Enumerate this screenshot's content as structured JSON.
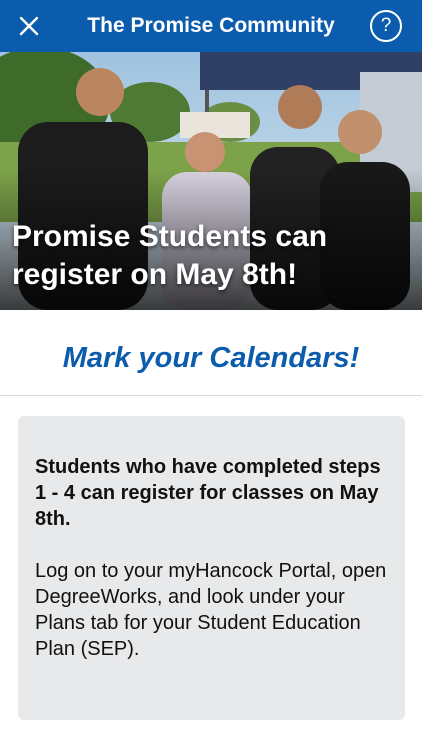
{
  "header": {
    "title": "The Promise Community",
    "close_icon": "close-icon",
    "help_icon": "help-icon",
    "help_glyph": "?"
  },
  "hero": {
    "headline": "Promise Students can register on May 8th!"
  },
  "subtitle": "Mark your Calendars!",
  "card": {
    "paragraph1": "Students who have completed steps 1 - 4 can register for classes on May 8th.",
    "paragraph2": "Log on to your myHancock Portal, open DegreeWorks, and look under your Plans tab for your Student Education Plan (SEP)."
  },
  "colors": {
    "brand": "#0b5cad",
    "card_bg": "#e8e9eb"
  }
}
